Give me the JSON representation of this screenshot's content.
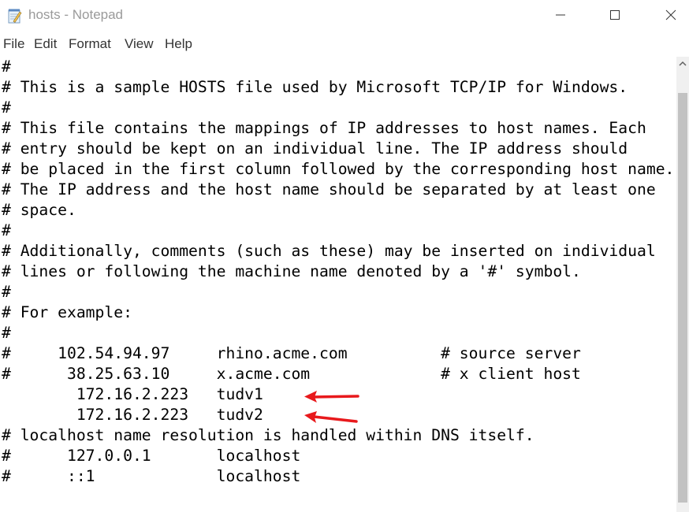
{
  "window": {
    "title": "hosts - Notepad",
    "icons": [
      "notepad-app-icon",
      "minimize-icon",
      "maximize-icon",
      "close-icon"
    ]
  },
  "menu": [
    "File",
    "Edit",
    "Format",
    "View",
    "Help"
  ],
  "editor": {
    "lines": [
      "#",
      "# This is a sample HOSTS file used by Microsoft TCP/IP for Windows.",
      "#",
      "# This file contains the mappings of IP addresses to host names. Each",
      "# entry should be kept on an individual line. The IP address should",
      "# be placed in the first column followed by the corresponding host name.",
      "# The IP address and the host name should be separated by at least one",
      "# space.",
      "#",
      "# Additionally, comments (such as these) may be inserted on individual",
      "# lines or following the machine name denoted by a '#' symbol.",
      "#",
      "# For example:",
      "#",
      "#     102.54.94.97     rhino.acme.com          # source server",
      "#      38.25.63.10     x.acme.com              # x client host",
      "        172.16.2.223   tudv1",
      "        172.16.2.223   tudv2",
      "# localhost name resolution is handled within DNS itself.",
      "#      127.0.0.1       localhost",
      "#      ::1             localhost"
    ]
  },
  "annotations": {
    "arrow_color": "#e8191c",
    "targets": [
      "tudv1",
      "tudv2"
    ]
  }
}
